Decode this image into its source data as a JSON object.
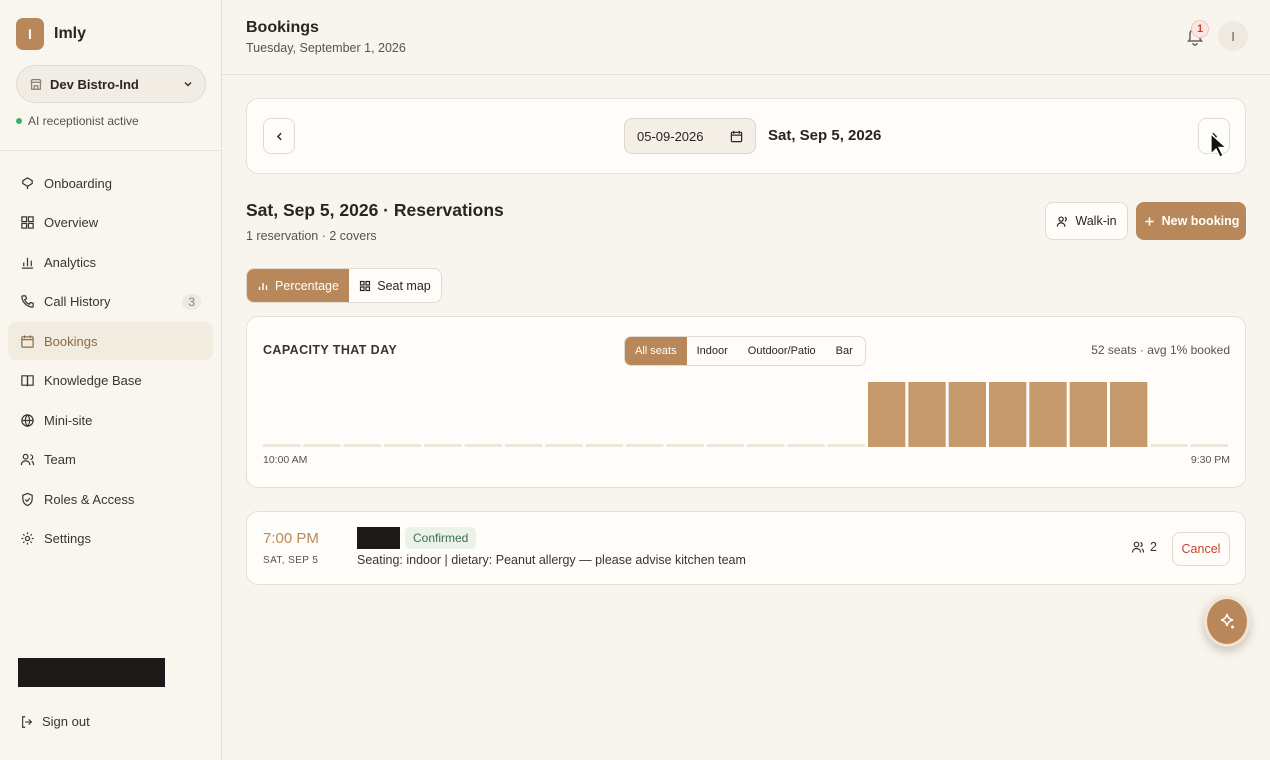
{
  "brand": {
    "initial": "I",
    "name": "Imly"
  },
  "restaurant": {
    "selected": "Dev Bistro-Ind"
  },
  "ai_status": "AI receptionist active",
  "sidebar": {
    "items": [
      {
        "label": "Onboarding",
        "icon": "onboarding-icon"
      },
      {
        "label": "Overview",
        "icon": "grid-icon"
      },
      {
        "label": "Analytics",
        "icon": "bar-chart-icon"
      },
      {
        "label": "Call History",
        "icon": "phone-icon",
        "badge": "3"
      },
      {
        "label": "Bookings",
        "icon": "calendar-icon",
        "active": true
      },
      {
        "label": "Knowledge Base",
        "icon": "book-icon"
      },
      {
        "label": "Mini-site",
        "icon": "globe-icon"
      },
      {
        "label": "Team",
        "icon": "users-icon"
      },
      {
        "label": "Roles & Access",
        "icon": "shield-icon"
      },
      {
        "label": "Settings",
        "icon": "gear-icon"
      }
    ],
    "signout": "Sign out"
  },
  "header": {
    "title": "Bookings",
    "date": "Tuesday, September 1, 2026",
    "notifications": "1",
    "avatar": "I"
  },
  "date_nav": {
    "input_value": "05-09-2026",
    "label": "Sat, Sep 5, 2026"
  },
  "reservations": {
    "title": "Sat, Sep 5, 2026 · Reservations",
    "subtitle": "1 reservation · 2 covers",
    "walkin_label": "Walk-in",
    "new_booking_label": "New booking"
  },
  "view_toggle": {
    "percentage": "Percentage",
    "seat_map": "Seat map"
  },
  "capacity": {
    "title": "CAPACITY THAT DAY",
    "filters": [
      "All seats",
      "Indoor",
      "Outdoor/Patio",
      "Bar"
    ],
    "selected_filter": "All seats",
    "summary": "52 seats · avg 1% booked",
    "start_label": "10:00 AM",
    "end_label": "9:30 PM"
  },
  "chart_data": {
    "type": "bar",
    "categories": [
      "10:00 AM",
      "10:30 AM",
      "11:00 AM",
      "11:30 AM",
      "12:00 PM",
      "12:30 PM",
      "1:00 PM",
      "1:30 PM",
      "2:00 PM",
      "2:30 PM",
      "3:00 PM",
      "3:30 PM",
      "4:00 PM",
      "4:30 PM",
      "5:00 PM",
      "5:30 PM",
      "6:00 PM",
      "6:30 PM",
      "7:00 PM",
      "7:30 PM",
      "8:00 PM",
      "8:30 PM",
      "9:00 PM",
      "9:30 PM"
    ],
    "values": [
      0,
      0,
      0,
      0,
      0,
      0,
      0,
      0,
      0,
      0,
      0,
      0,
      0,
      0,
      0,
      4,
      4,
      4,
      4,
      4,
      4,
      4,
      0,
      0
    ],
    "ylim": [
      0,
      4
    ],
    "bar_color": "#c49a6c",
    "empty_color": "#ece6dc"
  },
  "booking": {
    "time": "7:00 PM",
    "date": "SAT, SEP 5",
    "status": "Confirmed",
    "note": "Seating: indoor | dietary: Peanut allergy — please advise kitchen team",
    "covers": "2",
    "cancel_label": "Cancel"
  },
  "colors": {
    "accent": "#b8885a",
    "danger": "#c4472f",
    "success": "#3fae6a"
  }
}
